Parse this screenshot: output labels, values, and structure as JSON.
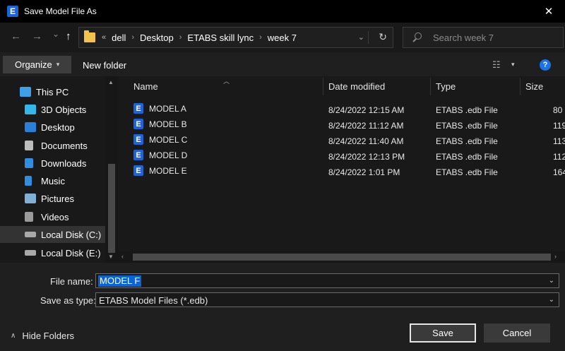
{
  "window": {
    "title": "Save Model File As",
    "app_icon_letter": "E",
    "close_glyph": "✕"
  },
  "nav": {
    "back_glyph": "←",
    "forward_glyph": "→",
    "recent_glyph": "⌄",
    "up_glyph": "↑"
  },
  "address": {
    "lead": "«",
    "crumbs": [
      "dell",
      "Desktop",
      "ETABS skill lync",
      "week 7"
    ],
    "sep": "›",
    "dropdown_glyph": "⌄",
    "refresh_glyph": "↻"
  },
  "search": {
    "placeholder": "Search week 7"
  },
  "commands": {
    "organize": "Organize",
    "organize_caret": "▾",
    "new_folder": "New folder",
    "view_glyph": "☷",
    "view_caret": "▾",
    "help": "?"
  },
  "sidebar": {
    "items": [
      {
        "label": "This PC",
        "icon": "computer-icon",
        "color": "#3fa0e8"
      },
      {
        "label": "3D Objects",
        "icon": "cube-icon",
        "color": "#35b6e8"
      },
      {
        "label": "Desktop",
        "icon": "desktop-icon",
        "color": "#2a7fd8"
      },
      {
        "label": "Documents",
        "icon": "document-icon",
        "color": "#bdbdbd"
      },
      {
        "label": "Downloads",
        "icon": "download-icon",
        "color": "#2f8ee0"
      },
      {
        "label": "Music",
        "icon": "music-icon",
        "color": "#2f8ee0"
      },
      {
        "label": "Pictures",
        "icon": "pictures-icon",
        "color": "#7fb0d8"
      },
      {
        "label": "Videos",
        "icon": "videos-icon",
        "color": "#9a9a9a"
      },
      {
        "label": "Local Disk (C:)",
        "icon": "drive-icon",
        "color": "#a9a9a9"
      },
      {
        "label": "Local Disk (E:)",
        "icon": "drive-icon",
        "color": "#a9a9a9"
      }
    ],
    "selected_index": 8,
    "scroll_up": "▲",
    "scroll_down": "▼"
  },
  "columns": {
    "name": "Name",
    "date": "Date modified",
    "type": "Type",
    "size": "Size",
    "sort_glyph": "︿"
  },
  "files": [
    {
      "name": "MODEL A",
      "date": "8/24/2022 12:15 AM",
      "type": "ETABS .edb File",
      "size": "80"
    },
    {
      "name": "MODEL B",
      "date": "8/24/2022 11:12 AM",
      "type": "ETABS .edb File",
      "size": "119"
    },
    {
      "name": "MODEL C",
      "date": "8/24/2022 11:40 AM",
      "type": "ETABS .edb File",
      "size": "113"
    },
    {
      "name": "MODEL D",
      "date": "8/24/2022 12:13 PM",
      "type": "ETABS .edb File",
      "size": "112"
    },
    {
      "name": "MODEL E",
      "date": "8/24/2022 1:01 PM",
      "type": "ETABS .edb File",
      "size": "164"
    }
  ],
  "file_icon_letter": "E",
  "hscroll": {
    "left": "‹",
    "right": "›"
  },
  "form": {
    "file_name_label": "File name:",
    "file_name_value": "MODEL F",
    "save_type_label": "Save as type:",
    "save_type_value": "ETABS Model Files (*.edb)",
    "caret": "⌄"
  },
  "footer": {
    "hide_folders": "Hide Folders",
    "hide_caret": "∧",
    "save": "Save",
    "cancel": "Cancel"
  }
}
